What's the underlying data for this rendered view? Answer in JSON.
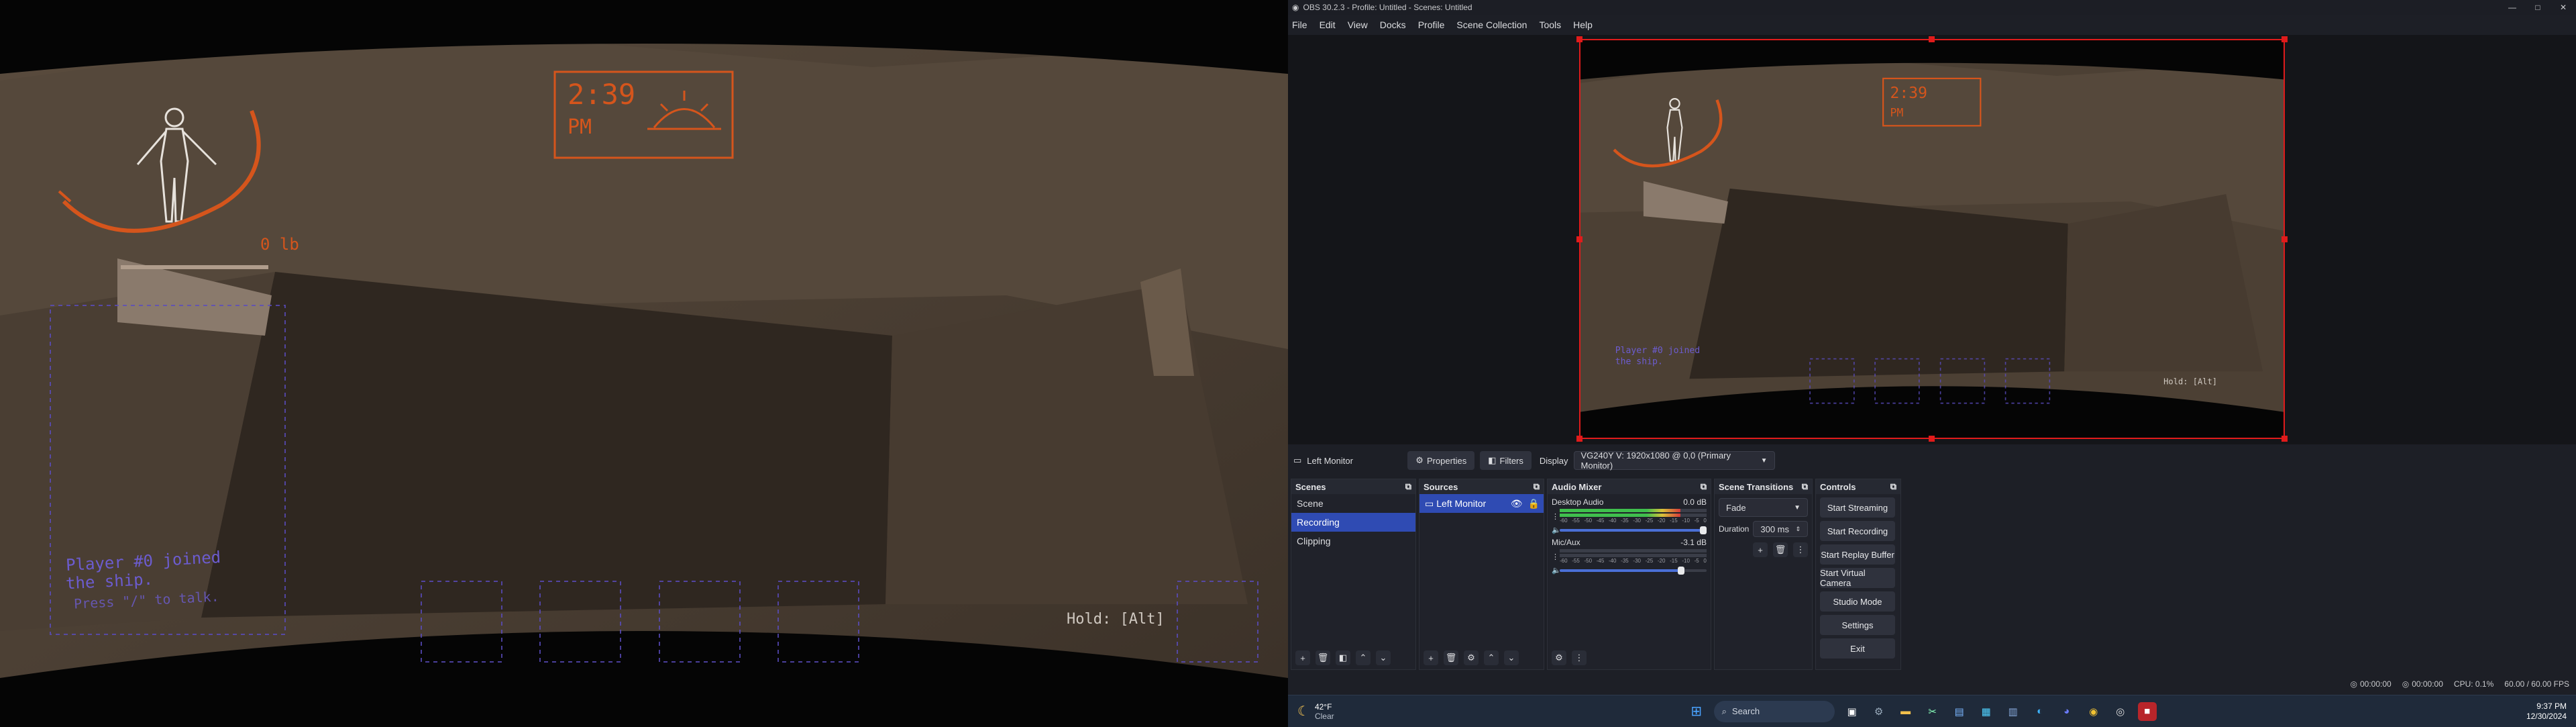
{
  "game": {
    "clock_time": "2:39",
    "clock_period": "PM",
    "weight": "0 lb",
    "chat_line1": "Player #0 joined",
    "chat_line2": "the ship.",
    "chat_line3": "Press \"/\" to talk.",
    "hold_hint": "Hold: [Alt]"
  },
  "obs": {
    "window_title": "OBS 30.2.3 - Profile: Untitled - Scenes: Untitled",
    "menu": [
      "File",
      "Edit",
      "View",
      "Docks",
      "Profile",
      "Scene Collection",
      "Tools",
      "Help"
    ],
    "source_bar": {
      "source_name": "Left Monitor",
      "properties_label": "Properties",
      "filters_label": "Filters",
      "display_label": "Display",
      "display_value": "VG240Y V: 1920x1080 @ 0,0 (Primary Monitor)"
    },
    "scenes": {
      "title": "Scenes",
      "items": [
        "Scene",
        "Recording",
        "Clipping"
      ],
      "selected": "Recording"
    },
    "sources": {
      "title": "Sources",
      "items": [
        "Left Monitor"
      ]
    },
    "audio_mixer": {
      "title": "Audio Mixer",
      "ticks": [
        "-60",
        "-55",
        "-50",
        "-45",
        "-40",
        "-35",
        "-30",
        "-25",
        "-20",
        "-15",
        "-10",
        "-5",
        "0"
      ],
      "channels": [
        {
          "name": "Desktop Audio",
          "db": "0.0 dB",
          "level": 0.82,
          "volume": 1.0
        },
        {
          "name": "Mic/Aux",
          "db": "-3.1 dB",
          "level": 0.0,
          "volume": 0.85
        }
      ]
    },
    "transitions": {
      "title": "Scene Transitions",
      "type": "Fade",
      "duration_label": "Duration",
      "duration_value": "300 ms"
    },
    "controls": {
      "title": "Controls",
      "buttons": [
        "Start Streaming",
        "Start Recording",
        "Start Replay Buffer",
        "Start Virtual Camera",
        "Studio Mode",
        "Settings",
        "Exit"
      ]
    },
    "status": {
      "rec_time": "00:00:00",
      "stream_time": "00:00:00",
      "cpu": "CPU: 0.1%",
      "fps": "60.00 / 60.00 FPS"
    }
  },
  "taskbar": {
    "weather_temp": "42°F",
    "weather_desc": "Clear",
    "search_placeholder": "Search",
    "clock_time": "9:37 PM",
    "clock_date": "12/30/2024"
  },
  "colors": {
    "hud_orange": "#d5551c",
    "hud_blue": "#6c5ccf",
    "obs_selection": "#2f4bb3",
    "preview_outline": "#e01b1b"
  }
}
